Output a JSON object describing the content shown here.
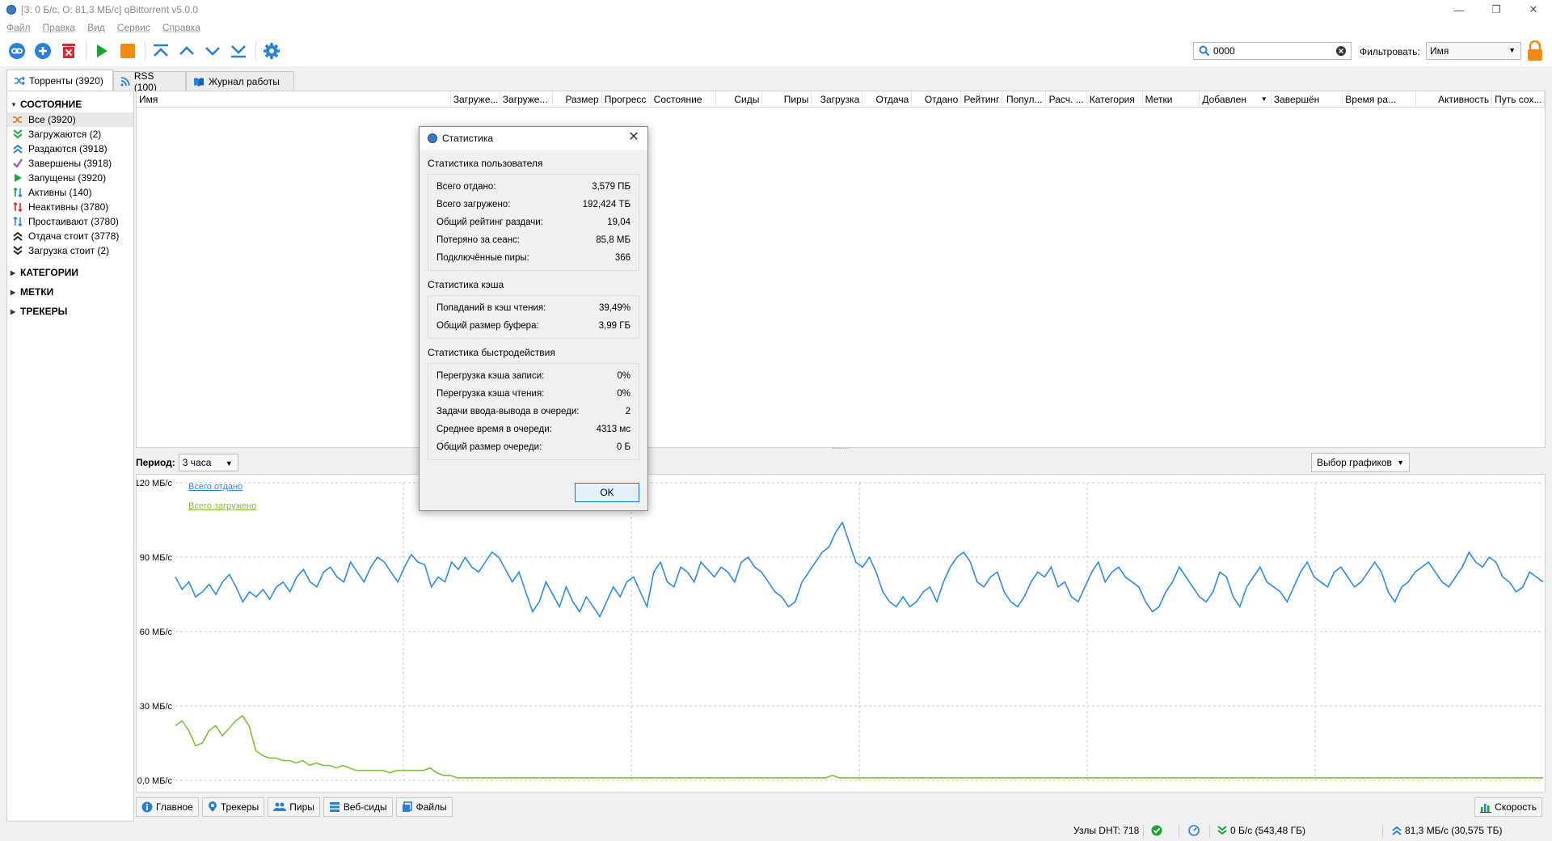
{
  "window": {
    "title": "[З: 0 Б/с, О: 81,3 МБ/с] qBittorrent v5.0.0"
  },
  "menu": [
    "Файл",
    "Правка",
    "Вид",
    "Сервис",
    "Справка"
  ],
  "search": {
    "value": "0000"
  },
  "filter": {
    "label": "Фильтровать:",
    "selected": "Имя"
  },
  "tabs": [
    {
      "label": "Торренты (3920)"
    },
    {
      "label": "RSS (100)"
    },
    {
      "label": "Журнал работы"
    }
  ],
  "sidebar": {
    "status_header": "СОСТОЯНИЕ",
    "items": [
      {
        "label": "Все (3920)",
        "icon": "shuffle-icon"
      },
      {
        "label": "Загружаются (2)",
        "icon": "download-chevrons-icon"
      },
      {
        "label": "Раздаются (3918)",
        "icon": "upload-chevrons-icon"
      },
      {
        "label": "Завершены (3918)",
        "icon": "checkmark-icon"
      },
      {
        "label": "Запущены (3920)",
        "icon": "play-icon"
      },
      {
        "label": "Активны (140)",
        "icon": "updown-arrows-icon"
      },
      {
        "label": "Неактивны (3780)",
        "icon": "updown-arrows-red-icon"
      },
      {
        "label": "Простаивают (3780)",
        "icon": "updown-arrows-blue-icon"
      },
      {
        "label": "Отдача стоит (3778)",
        "icon": "upload-stalled-icon"
      },
      {
        "label": "Загрузка стоит (2)",
        "icon": "download-stalled-icon"
      }
    ],
    "sections": [
      "КАТЕГОРИИ",
      "МЕТКИ",
      "ТРЕКЕРЫ"
    ]
  },
  "table": {
    "columns": [
      "Имя",
      "Загруже...",
      "Загруже...",
      "Размер",
      "Прогресс",
      "Состояние",
      "Сиды",
      "Пиры",
      "Загрузка",
      "Отдача",
      "Отдано",
      "Рейтинг",
      "Попул...",
      "Расч. ...",
      "Категория",
      "Метки",
      "Добавлен",
      "Завершён",
      "Время ра...",
      "Активность",
      "Путь сох..."
    ]
  },
  "graph": {
    "period_label": "Период:",
    "period_value": "3 часа",
    "select_label": "Выбор графиков",
    "y_ticks": [
      "120 МБ/с",
      "90 МБ/с",
      "60 МБ/с",
      "30 МБ/с",
      "0,0 МБ/с"
    ],
    "legend": [
      {
        "label": "Всего отдано",
        "color": "#2f8ae0"
      },
      {
        "label": "Всего загружено",
        "color": "#7dc13c"
      }
    ]
  },
  "chart_data": {
    "type": "line",
    "ylim": [
      0,
      120
    ],
    "series": [
      {
        "name": "Всего отдано",
        "color": "#2f8ae0",
        "values": [
          82,
          77,
          80,
          74,
          76,
          79,
          75,
          80,
          83,
          78,
          72,
          76,
          74,
          77,
          73,
          78,
          80,
          76,
          82,
          85,
          80,
          78,
          84,
          86,
          82,
          80,
          88,
          84,
          80,
          86,
          90,
          88,
          84,
          80,
          86,
          91,
          88,
          87,
          78,
          82,
          80,
          88,
          85,
          90,
          86,
          84,
          88,
          92,
          90,
          85,
          80,
          84,
          76,
          68,
          72,
          80,
          75,
          70,
          78,
          72,
          68,
          74,
          70,
          66,
          72,
          78,
          74,
          80,
          82,
          76,
          70,
          84,
          88,
          80,
          78,
          86,
          84,
          80,
          88,
          85,
          82,
          86,
          84,
          80,
          88,
          90,
          86,
          84,
          80,
          76,
          74,
          70,
          72,
          80,
          84,
          88,
          92,
          94,
          100,
          104,
          96,
          88,
          86,
          90,
          84,
          76,
          72,
          70,
          74,
          70,
          72,
          76,
          78,
          72,
          80,
          86,
          90,
          92,
          88,
          80,
          78,
          82,
          84,
          76,
          72,
          70,
          74,
          80,
          84,
          82,
          86,
          78,
          80,
          74,
          72,
          78,
          84,
          88,
          80,
          84,
          86,
          82,
          80,
          78,
          72,
          68,
          70,
          76,
          80,
          86,
          82,
          78,
          74,
          72,
          76,
          84,
          82,
          74,
          70,
          78,
          82,
          86,
          80,
          78,
          76,
          72,
          78,
          84,
          88,
          82,
          80,
          78,
          84,
          86,
          82,
          78,
          80,
          84,
          88,
          84,
          76,
          72,
          78,
          80,
          84,
          86,
          88,
          84,
          80,
          78,
          82,
          86,
          92,
          88,
          86,
          90,
          88,
          82,
          80,
          76,
          78,
          84,
          82,
          80
        ]
      },
      {
        "name": "Всего загружено",
        "color": "#7dc13c",
        "values": [
          22,
          24,
          20,
          14,
          15,
          20,
          22,
          18,
          21,
          24,
          26,
          22,
          12,
          10,
          9,
          9,
          8,
          8,
          7,
          8,
          6,
          7,
          6,
          6,
          5,
          6,
          5,
          4,
          4,
          4,
          4,
          4,
          3,
          4,
          4,
          4,
          4,
          4,
          5,
          3,
          2,
          2,
          1,
          1,
          1,
          1,
          1,
          1,
          1,
          1,
          1,
          1,
          1,
          1,
          1,
          1,
          1,
          1,
          1,
          1,
          1,
          1,
          1,
          1,
          1,
          1,
          1,
          1,
          1,
          1,
          1,
          1,
          1,
          1,
          1,
          1,
          1,
          1,
          1,
          1,
          1,
          1,
          1,
          1,
          1,
          1,
          1,
          1,
          1,
          1,
          1,
          1,
          1,
          1,
          1,
          1,
          1,
          1,
          2,
          1,
          1,
          1,
          1,
          1,
          1,
          1,
          1,
          1,
          1,
          1,
          1,
          1,
          1,
          1,
          1,
          1,
          1,
          1,
          1,
          1,
          1,
          1,
          1,
          1,
          1,
          1,
          1,
          1,
          1,
          1,
          1,
          1,
          1,
          1,
          1,
          1,
          1,
          1,
          1,
          1,
          1,
          1,
          1,
          1,
          1,
          1,
          1,
          1,
          1,
          1,
          1,
          1,
          1,
          1,
          1,
          1,
          1,
          1,
          1,
          1,
          1,
          1,
          1,
          1,
          1,
          1,
          1,
          1,
          1,
          1,
          1,
          1,
          1,
          1,
          1,
          1,
          1,
          1,
          1,
          1,
          1,
          1,
          1,
          1,
          1,
          1,
          1,
          1,
          1,
          1,
          1,
          1,
          1,
          1,
          1,
          1,
          1,
          1,
          1,
          1,
          1,
          1,
          1,
          1,
          1
        ]
      }
    ]
  },
  "bottom_tabs": [
    "Главное",
    "Трекеры",
    "Пиры",
    "Веб-сиды",
    "Файлы"
  ],
  "speed_tab": "Скорость",
  "statusbar": {
    "dht": "Узлы DHT: 718",
    "download": "0 Б/с (543,48 ГБ)",
    "upload": "81,3 МБ/с (30,575 ТБ)"
  },
  "dialog": {
    "title": "Статистика",
    "user_group": "Статистика пользователя",
    "user_rows": [
      {
        "label": "Всего отдано:",
        "value": "3,579 ПБ"
      },
      {
        "label": "Всего загружено:",
        "value": "192,424 ТБ"
      },
      {
        "label": "Общий рейтинг раздачи:",
        "value": "19,04"
      },
      {
        "label": "Потеряно за сеанс:",
        "value": "85,8 МБ"
      },
      {
        "label": "Подключённые пиры:",
        "value": "366"
      }
    ],
    "cache_group": "Статистика кэша",
    "cache_rows": [
      {
        "label": "Попаданий в кэш чтения:",
        "value": "39,49%"
      },
      {
        "label": "Общий размер буфера:",
        "value": "3,99 ГБ"
      }
    ],
    "perf_group": "Статистика быстродействия",
    "perf_rows": [
      {
        "label": "Перегрузка кэша записи:",
        "value": "0%"
      },
      {
        "label": "Перегрузка кэша чтения:",
        "value": "0%"
      },
      {
        "label": "Задачи ввода-вывода в очереди:",
        "value": "2"
      },
      {
        "label": "Среднее время в очереди:",
        "value": "4313 мс"
      },
      {
        "label": "Общий размер очереди:",
        "value": "0 Б"
      }
    ],
    "ok_label": "OK"
  }
}
